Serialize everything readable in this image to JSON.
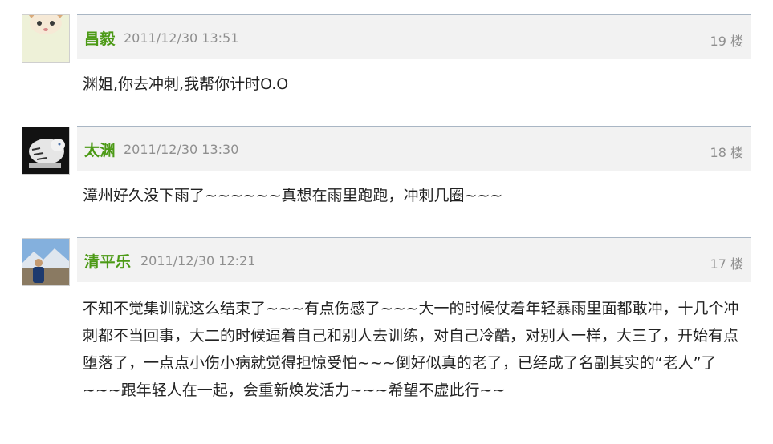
{
  "comments": [
    {
      "author": "昌毅",
      "time": "2011/12/30 13:51",
      "floor": "19 楼",
      "text": "渊姐,你去冲刺,我帮你计时O.O"
    },
    {
      "author": "太渊",
      "time": "2011/12/30 13:30",
      "floor": "18 楼",
      "text": "漳州好久没下雨了~~~~~~真想在雨里跑跑，冲刺几圈~~~"
    },
    {
      "author": "清平乐",
      "time": "2011/12/30 12:21",
      "floor": "17 楼",
      "text": "不知不觉集训就这么结束了~~~有点伤感了~~~大一的时候仗着年轻暴雨里面都敢冲，十几个冲刺都不当回事，大二的时候逼着自己和别人去训练，对自己冷酷，对别人一样，大三了，开始有点堕落了，一点点小伤小病就觉得担惊受怕~~~倒好似真的老了，已经成了名副其实的“老人”了~~~跟年轻人在一起，会重新焕发活力~~~希望不虚此行~~"
    }
  ],
  "avatars": [
    "cat-avatar",
    "white-tiger-avatar",
    "mountain-person-avatar"
  ]
}
